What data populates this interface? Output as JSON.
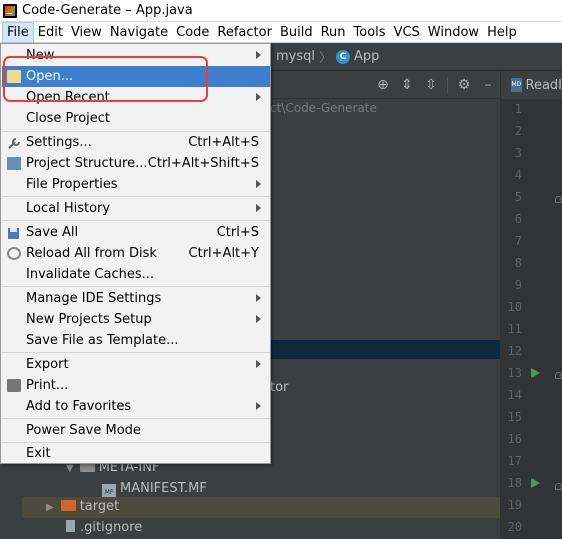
{
  "window": {
    "title": "Code-Generate – App.java"
  },
  "menubar": {
    "items": [
      "File",
      "Edit",
      "View",
      "Navigate",
      "Code",
      "Refactor",
      "Build",
      "Run",
      "Tools",
      "VCS",
      "Window",
      "Help"
    ]
  },
  "navbar": {
    "crumb_mysql": "mysql",
    "crumb_app": "App",
    "class_icon_letter": "C"
  },
  "project": {
    "path": "ct\\Code-Generate",
    "tree_partial_text": "tor",
    "meta_inf": "META-INF",
    "manifest": "MANIFEST.MF",
    "target": "target",
    "gitignore": ".gitignore"
  },
  "editor": {
    "tab_label": "ReadI",
    "tab_icon_text": "MD",
    "line_numbers": [
      "1",
      "2",
      "3",
      "4",
      "5",
      "6",
      "7",
      "8",
      "9",
      "10",
      "11",
      "12",
      "13",
      "14",
      "15",
      "16",
      "17",
      "18",
      "19",
      "20"
    ]
  },
  "file_menu": {
    "new": "New",
    "open": "Open...",
    "open_recent": "Open Recent",
    "close_project": "Close Project",
    "settings": "Settings...",
    "settings_shortcut": "Ctrl+Alt+S",
    "project_structure": "Project Structure...",
    "project_structure_shortcut": "Ctrl+Alt+Shift+S",
    "file_properties": "File Properties",
    "local_history": "Local History",
    "save_all": "Save All",
    "save_all_shortcut": "Ctrl+S",
    "reload_all": "Reload All from Disk",
    "reload_all_shortcut": "Ctrl+Alt+Y",
    "invalidate_caches": "Invalidate Caches...",
    "manage_ide_settings": "Manage IDE Settings",
    "new_projects_setup": "New Projects Setup",
    "save_as_template": "Save File as Template...",
    "export": "Export",
    "print": "Print...",
    "add_to_favorites": "Add to Favorites",
    "power_save_mode": "Power Save Mode",
    "exit": "Exit"
  },
  "colors": {
    "highlight": "#3d7fcd",
    "annotation_box": "#e7403c",
    "run_arrow": "#499c54"
  }
}
